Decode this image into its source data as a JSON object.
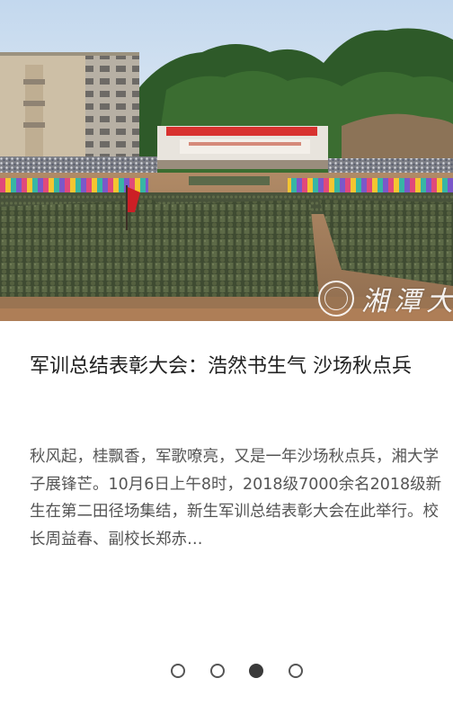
{
  "article": {
    "image_alt": "军训总结表彰大会现场",
    "watermark_text": "湘潭大",
    "title": "军训总结表彰大会：浩然书生气 沙场秋点兵",
    "summary": "秋风起，桂飘香，军歌嘹亮，又是一年沙场秋点兵，湘大学子展锋芒。10月6日上午8时，2018级7000余名2018级新生在第二田径场集结，新生军训总结表彰大会在此举行。校长周益春、副校长郑赤…"
  },
  "pager": {
    "total": 4,
    "active_index": 2
  },
  "colors": {
    "sky": "#c9dcee",
    "hill": "#2f5e2a",
    "uniform": "#4d5a3d",
    "ground": "#a07a58",
    "banner": "#d8322f"
  }
}
